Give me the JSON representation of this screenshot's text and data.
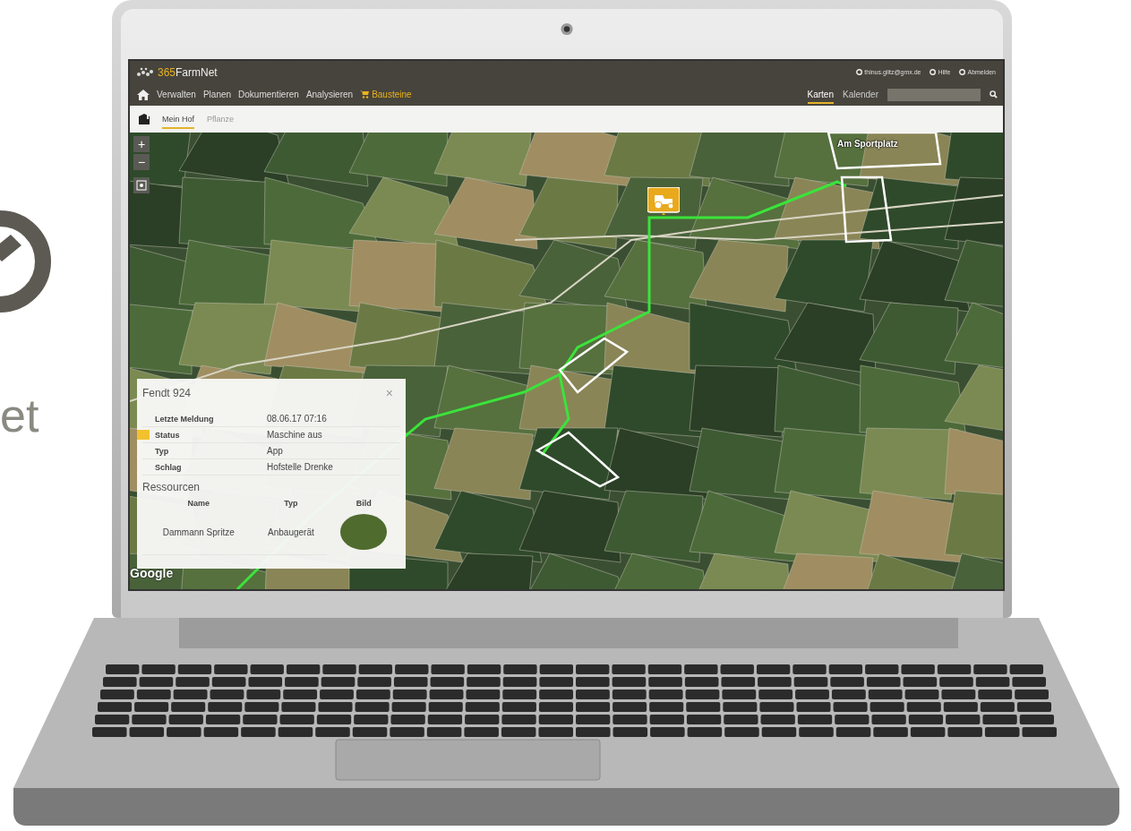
{
  "brand": {
    "text": "et"
  },
  "header": {
    "logo_text": "365FarmNet",
    "user": "thinus.glitz@gmx.de",
    "help": "Hilfe",
    "logout": "Abmelden"
  },
  "nav": [
    {
      "label": "Verwalten",
      "kind": "link"
    },
    {
      "label": "Planen",
      "kind": "link"
    },
    {
      "label": "Dokumentieren",
      "kind": "link"
    },
    {
      "label": "Analysieren",
      "kind": "link"
    },
    {
      "label": "Bausteine",
      "kind": "shop"
    }
  ],
  "view_tabs": [
    {
      "label": "Karten",
      "selected": true
    },
    {
      "label": "Kalender",
      "selected": false
    }
  ],
  "sub_tabs": [
    {
      "label": "Mein Hof",
      "selected": true
    },
    {
      "label": "Pflanze",
      "selected": false
    }
  ],
  "map": {
    "zoom_in": "+",
    "zoom_out": "−",
    "labels": [
      {
        "text": "Am Sportplatz"
      }
    ],
    "attribution": "Google"
  },
  "popup": {
    "title": "Fendt 924",
    "close": "×",
    "fields": [
      {
        "label": "Letzte Meldung",
        "value": "08.06.17 07:16"
      },
      {
        "label": "Status",
        "value": "Maschine aus",
        "color": "#f2c12e"
      },
      {
        "label": "Typ",
        "value": "App"
      },
      {
        "label": "Schlag",
        "value": "Hofstelle Drenke"
      }
    ],
    "resources_title": "Ressourcen",
    "columns": [
      "Name",
      "Typ",
      "Bild"
    ],
    "rows": [
      {
        "name": "Dammann Spritze",
        "type": "Anbaugerät"
      }
    ]
  }
}
